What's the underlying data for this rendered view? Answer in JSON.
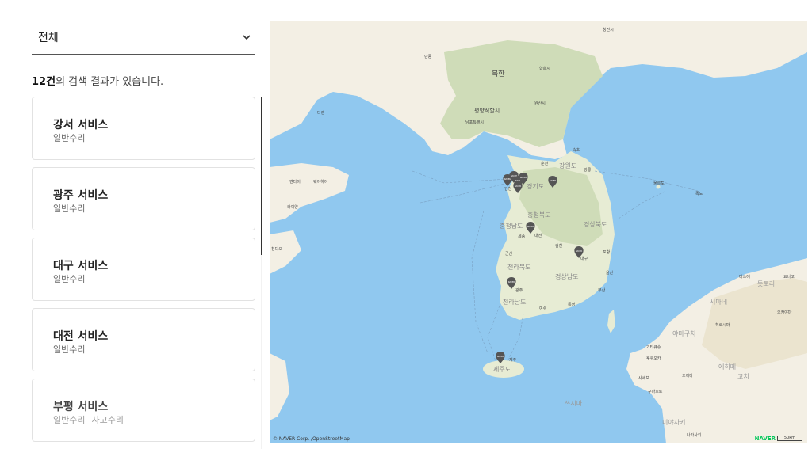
{
  "filter": {
    "selected": "전체"
  },
  "result": {
    "count": "12건",
    "suffix": "의 검색 결과가 있습니다."
  },
  "services": [
    {
      "name": "강서 서비스",
      "tags": [
        "일반수리"
      ]
    },
    {
      "name": "광주 서비스",
      "tags": [
        "일반수리"
      ]
    },
    {
      "name": "대구 서비스",
      "tags": [
        "일반수리"
      ]
    },
    {
      "name": "대전 서비스",
      "tags": [
        "일반수리"
      ]
    },
    {
      "name": "부평 서비스",
      "tags": [
        "일반수리",
        "사고수리"
      ]
    }
  ],
  "map": {
    "labels": {
      "bukhan": "북한",
      "pyongyang": "평양직할시",
      "chuncheon": "춘천",
      "gangwon": "강원도",
      "incheon": "인천",
      "gyeonggi": "경기도",
      "chungbuk": "충청북도",
      "chungnam": "충청남도",
      "gyeongbuk": "경상북도",
      "sejong": "세종",
      "daejeon": "대전",
      "gimcheon": "김천",
      "daegu": "대구",
      "pohang": "포항",
      "jeonbuk": "전라북도",
      "gunsan": "군산",
      "gwangju": "광주",
      "jeonnam": "전라남도",
      "gyeongnam": "경상남도",
      "ulsan": "울산",
      "busan": "부산",
      "yeosu": "여수",
      "tongyeong": "통영",
      "jejudo": "제주도",
      "jeju": "제주",
      "sokcho": "속초",
      "gangneung": "강릉",
      "ulleungdo": "울릉도",
      "dokdo": "독도",
      "danthung": "단둥",
      "hamheung": "함흥시",
      "wonsan": "원산시",
      "nampo": "남포특별시",
      "dalian": "다롄",
      "weihai": "웨이하이",
      "yantai": "옌타이",
      "laiyang": "라이양",
      "qingdao": "칭다오",
      "yokjin": "청진시",
      "kitakyushu": "기타큐슈",
      "fukuoka": "후쿠오카",
      "hiroshima": "히로시마",
      "yamaguchi": "야마구치",
      "shimane": "시마네",
      "tottori": "돗토리",
      "okayama": "오카야마",
      "ehime": "에히메",
      "kochi": "고치",
      "miyazaki": "미야자키",
      "kumamoto": "구마모토",
      "saga": "사세보",
      "oita": "오이타",
      "nagasaki": "나가사키",
      "tsushima": "쓰시마",
      "matsue": "마쓰에",
      "yonago": "요나고"
    },
    "attribution": "© NAVER Corp. /OpenStreetMap",
    "brand": "NAVER",
    "scale": "50km",
    "marker_text": "NAVER"
  }
}
